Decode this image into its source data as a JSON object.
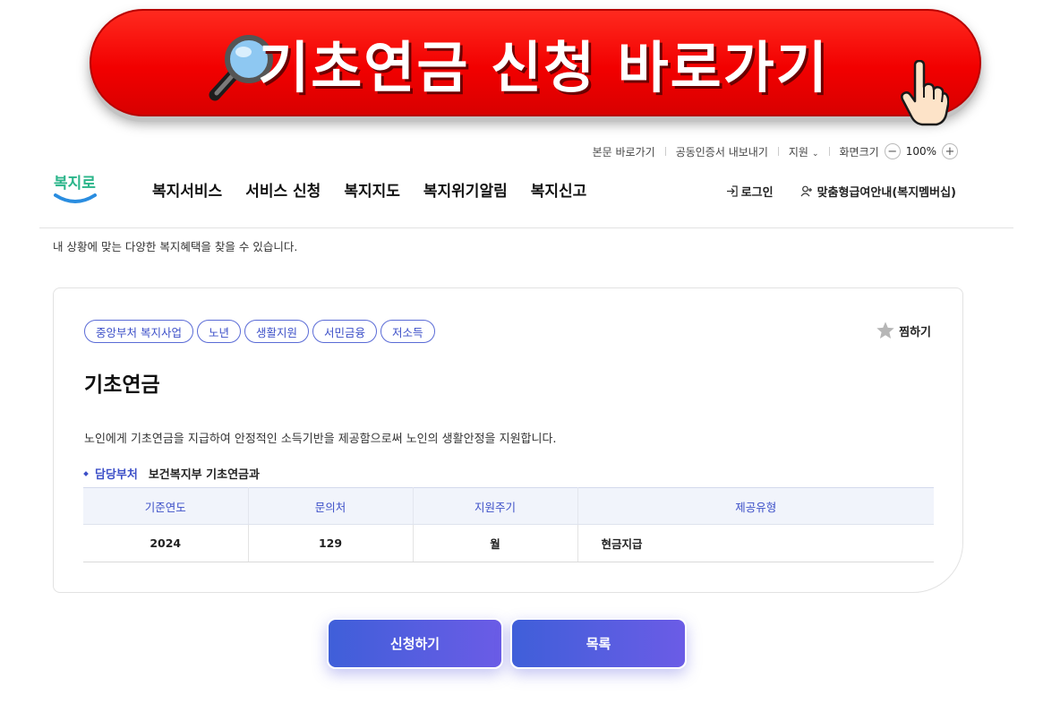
{
  "banner": {
    "title": "기초연금 신청 바로가기",
    "icons": [
      "magnifier-icon",
      "pointing-hand-icon"
    ],
    "color": "#f20000"
  },
  "utility": {
    "skip_to_content": "본문 바로가기",
    "export_cert": "공동인증서 내보내기",
    "support": "지원",
    "font_size_label": "화면크기",
    "zoom_out": "−",
    "zoom_value": "100%",
    "zoom_in": "+"
  },
  "header": {
    "logo_text": "복지로",
    "nav": [
      "복지서비스",
      "서비스 신청",
      "복지지도",
      "복지위기알림",
      "복지신고"
    ],
    "login": "로그인",
    "membership": "맞춤형급여안내(복지멤버십)"
  },
  "intro_text": "내 상황에 맞는 다양한 복지혜택을 찾을 수 있습니다.",
  "card": {
    "tags": [
      "중앙부처 복지사업",
      "노년",
      "생활지원",
      "서민금융",
      "저소득"
    ],
    "favorite_label": "찜하기",
    "title": "기초연금",
    "description": "노인에게 기초연금을 지급하여 안정적인 소득기반을 제공함으로써 노인의 생활안정을 지원합니다.",
    "department_label": "담당부처",
    "department_value": "보건복지부 기초연금과",
    "table": {
      "headers": [
        "기준연도",
        "문의처",
        "지원주기",
        "제공유형"
      ],
      "rows": [
        [
          "2024",
          "129",
          "월",
          "현금지급"
        ]
      ]
    }
  },
  "buttons": {
    "apply": "신청하기",
    "list": "목록"
  },
  "colors": {
    "accent": "#3d50c8",
    "button_gradient_start": "#3f5fd9",
    "button_gradient_end": "#6b5ce6"
  }
}
